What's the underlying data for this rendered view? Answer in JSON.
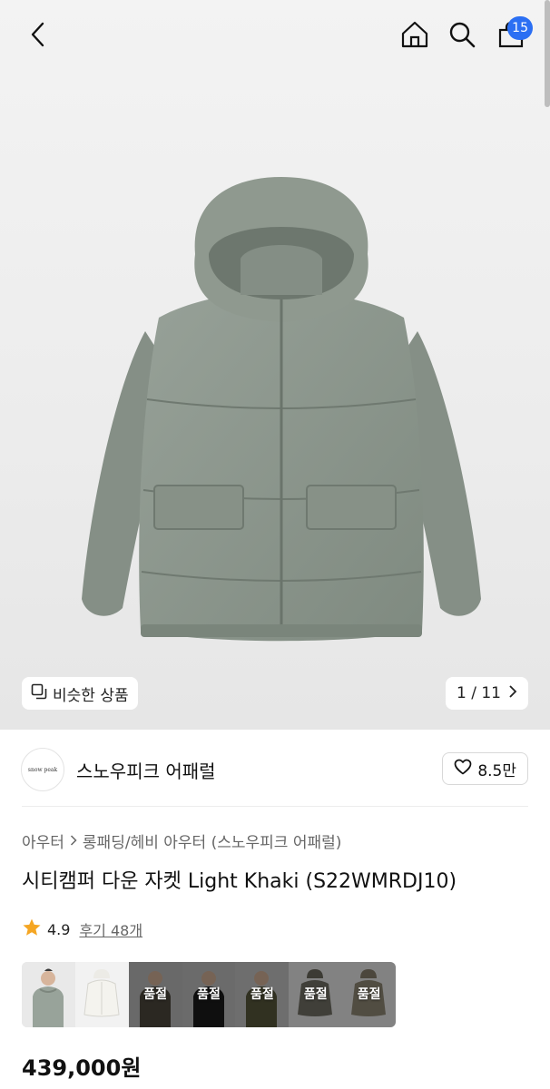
{
  "header": {
    "back_icon": "chevron-left-icon",
    "home_icon": "home-icon",
    "search_icon": "search-icon",
    "cart_icon": "shopping-bag-icon",
    "cart_count": "15"
  },
  "gallery": {
    "similar_label": "비슷한 상품",
    "page_indicator": "1 / 11"
  },
  "brand": {
    "logo_text": "snow peak",
    "name": "스노우피크 어패럴",
    "likes": "8.5만"
  },
  "product": {
    "breadcrumb": [
      "아우터",
      "롱패딩/헤비 아우터 (스노우피크 어패럴)"
    ],
    "title": "시티캠퍼 다운 자켓 Light Khaki (S22WMRDJ10)",
    "rating": "4.9",
    "reviews": "후기 48개",
    "price": "439,000원"
  },
  "variants": {
    "soldout_label": "품절",
    "items": [
      {
        "color": "light-khaki",
        "sold_out": false,
        "model": true
      },
      {
        "color": "ivory",
        "sold_out": false,
        "model": false
      },
      {
        "color": "khaki",
        "sold_out": true,
        "model": true
      },
      {
        "color": "black",
        "sold_out": true,
        "model": true
      },
      {
        "color": "olive",
        "sold_out": true,
        "model": true
      },
      {
        "color": "grey-khaki",
        "sold_out": true,
        "model": false
      },
      {
        "color": "beige-khaki",
        "sold_out": true,
        "model": false
      }
    ]
  },
  "colors": {
    "accent_badge": "#2b6ff3",
    "star": "#f5a623",
    "jacket": "#8e988f"
  }
}
